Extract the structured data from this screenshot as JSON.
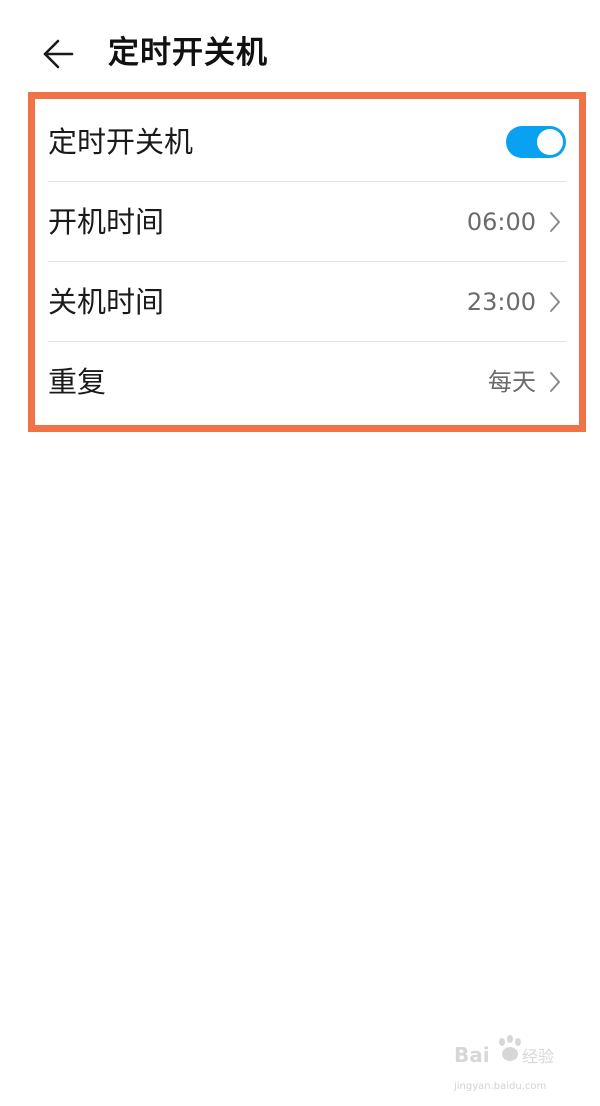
{
  "header": {
    "back_icon": "arrow-left-icon",
    "title": "定时开关机"
  },
  "colors": {
    "highlight_border": "#ef7346",
    "toggle_on": "#0aa2f0",
    "chevron": "#8a8a8a"
  },
  "settings": {
    "scheduled_power": {
      "label": "定时开关机",
      "enabled": true
    },
    "power_on_time": {
      "label": "开机时间",
      "value": "06:00",
      "icon": "chevron-right-icon"
    },
    "power_off_time": {
      "label": "关机时间",
      "value": "23:00",
      "icon": "chevron-right-icon"
    },
    "repeat": {
      "label": "重复",
      "value": "每天",
      "icon": "chevron-right-icon"
    }
  },
  "watermark": {
    "logo_text": "Bai百度经验",
    "sub_text": "jingyan.baidu.com"
  }
}
